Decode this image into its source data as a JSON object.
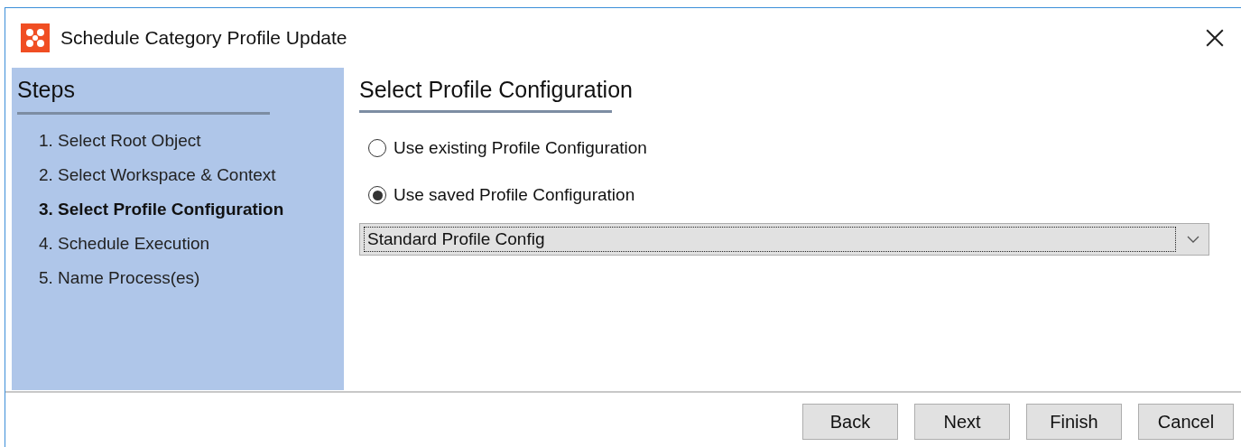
{
  "window": {
    "title": "Schedule Category Profile Update"
  },
  "steps": {
    "heading": "Steps",
    "items": [
      {
        "label": "1. Select Root Object",
        "selected": false
      },
      {
        "label": "2. Select Workspace & Context",
        "selected": false
      },
      {
        "label": "3. Select Profile Configuration",
        "selected": true
      },
      {
        "label": "4. Schedule Execution",
        "selected": false
      },
      {
        "label": "5. Name Process(es)",
        "selected": false
      }
    ]
  },
  "content": {
    "heading": "Select Profile Configuration",
    "options": [
      {
        "label": "Use existing Profile Configuration",
        "selected": false
      },
      {
        "label": "Use saved Profile Configuration",
        "selected": true
      }
    ],
    "dropdown": {
      "value": "Standard Profile Config"
    }
  },
  "buttons": [
    "Back",
    "Next",
    "Finish",
    "Cancel"
  ]
}
